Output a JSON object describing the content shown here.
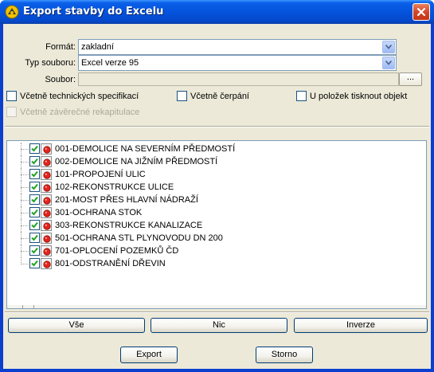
{
  "window": {
    "title": "Export stavby do Excelu"
  },
  "form": {
    "format_label": "Formát:",
    "format_value": "zakladní",
    "filetype_label": "Typ souboru:",
    "filetype_value": "Excel verze 95",
    "file_label": "Soubor:",
    "file_value": "",
    "browse_label": "..."
  },
  "options": {
    "tech_spec": "Včetně technických specifikací",
    "cerpani": "Včetně čerpání",
    "print_object": "U položek tisknout objekt",
    "final_recap": "Včetně závěrečné rekapitulace"
  },
  "tree": {
    "items": [
      "001-DEMOLICE NA SEVERNÍM PŘEDMOSTÍ",
      "002-DEMOLICE NA JIŽNÍM PŘEDMOSTÍ",
      "101-PROPOJENÍ ULIC",
      "102-REKONSTRUKCE ULICE",
      "201-MOST PŘES HLAVNÍ NÁDRAŽÍ",
      "301-OCHRANA STOK",
      "303-REKONSTRUKCE KANALIZACE",
      "501-OCHRANA STL PLYNOVODU DN 200",
      "701-OPLOCENÍ POZEMKŮ ČD",
      "801-ODSTRANĚNÍ DŘEVIN"
    ]
  },
  "selection_buttons": {
    "all": "Vše",
    "none": "Nic",
    "invert": "Inverze"
  },
  "dialog_buttons": {
    "export": "Export",
    "cancel": "Storno"
  }
}
